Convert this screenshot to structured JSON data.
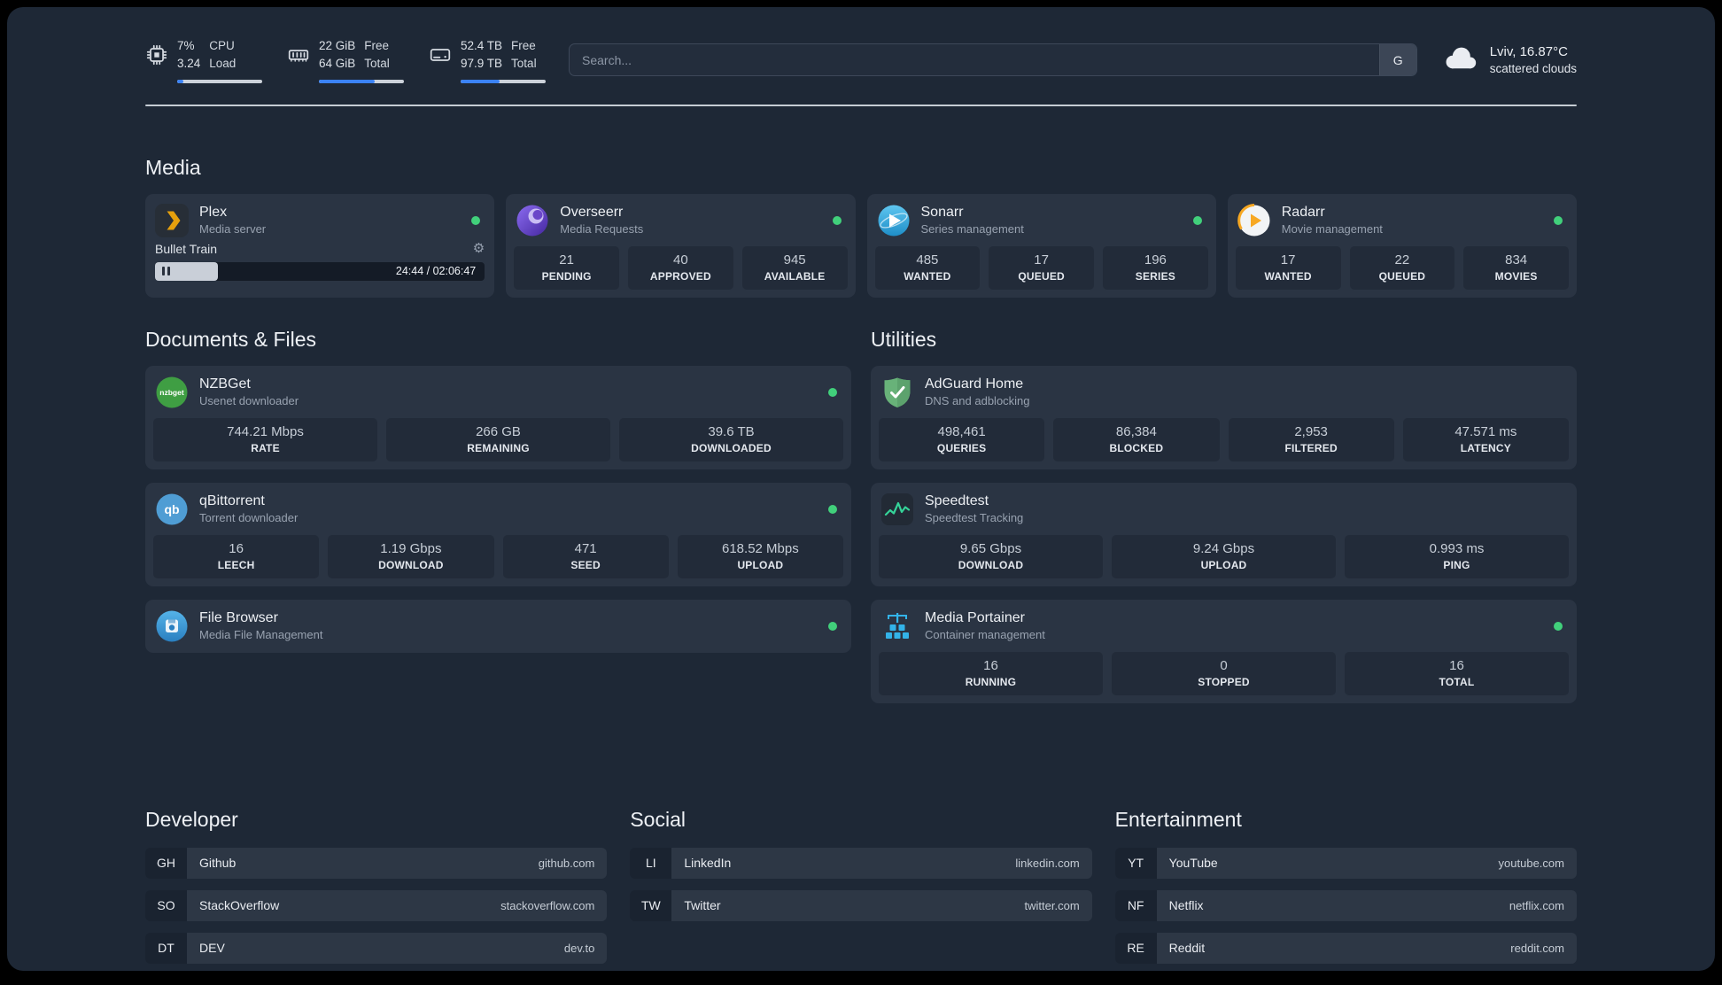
{
  "topbar": {
    "cpu": {
      "value_top": "7%",
      "value_bottom": "3.24",
      "label_top": "CPU",
      "label_bottom": "Load",
      "percent": 7
    },
    "memory": {
      "value_top": "22 GiB",
      "value_bottom": "64 GiB",
      "label_top": "Free",
      "label_bottom": "Total",
      "percent": 66
    },
    "disk": {
      "value_top": "52.4 TB",
      "value_bottom": "97.9 TB",
      "label_top": "Free",
      "label_bottom": "Total",
      "percent": 46
    },
    "search": {
      "placeholder": "Search...",
      "button_label": "G"
    },
    "weather": {
      "location": "Lviv, 16.87°C",
      "condition": "scattered clouds"
    }
  },
  "icons": {
    "gear": "⚙"
  },
  "colors": {
    "accent": "#3b82f6",
    "online": "#41d07b"
  },
  "sections": {
    "media": {
      "title": "Media",
      "plex": {
        "name": "Plex",
        "subtitle": "Media server",
        "status": "online",
        "now_playing": {
          "title": "Bullet Train",
          "time_display": "24:44 / 02:06:47",
          "progress_percent": 19
        }
      },
      "overseerr": {
        "name": "Overseerr",
        "subtitle": "Media Requests",
        "status": "online",
        "stats": [
          {
            "value": "21",
            "label": "PENDING"
          },
          {
            "value": "40",
            "label": "APPROVED"
          },
          {
            "value": "945",
            "label": "AVAILABLE"
          }
        ]
      },
      "sonarr": {
        "name": "Sonarr",
        "subtitle": "Series management",
        "status": "online",
        "stats": [
          {
            "value": "485",
            "label": "WANTED"
          },
          {
            "value": "17",
            "label": "QUEUED"
          },
          {
            "value": "196",
            "label": "SERIES"
          }
        ]
      },
      "radarr": {
        "name": "Radarr",
        "subtitle": "Movie management",
        "status": "online",
        "stats": [
          {
            "value": "17",
            "label": "WANTED"
          },
          {
            "value": "22",
            "label": "QUEUED"
          },
          {
            "value": "834",
            "label": "MOVIES"
          }
        ]
      }
    },
    "documents": {
      "title": "Documents & Files",
      "nzbget": {
        "name": "NZBGet",
        "subtitle": "Usenet downloader",
        "status": "online",
        "stats": [
          {
            "value": "744.21 Mbps",
            "label": "RATE"
          },
          {
            "value": "266 GB",
            "label": "REMAINING"
          },
          {
            "value": "39.6 TB",
            "label": "DOWNLOADED"
          }
        ]
      },
      "qbittorrent": {
        "name": "qBittorrent",
        "subtitle": "Torrent downloader",
        "status": "online",
        "stats": [
          {
            "value": "16",
            "label": "LEECH"
          },
          {
            "value": "1.19 Gbps",
            "label": "DOWNLOAD"
          },
          {
            "value": "471",
            "label": "SEED"
          },
          {
            "value": "618.52 Mbps",
            "label": "UPLOAD"
          }
        ]
      },
      "filebrowser": {
        "name": "File Browser",
        "subtitle": "Media File Management",
        "status": "online"
      }
    },
    "utilities": {
      "title": "Utilities",
      "adguard": {
        "name": "AdGuard Home",
        "subtitle": "DNS and adblocking",
        "stats": [
          {
            "value": "498,461",
            "label": "QUERIES"
          },
          {
            "value": "86,384",
            "label": "BLOCKED"
          },
          {
            "value": "2,953",
            "label": "FILTERED"
          },
          {
            "value": "47.571 ms",
            "label": "LATENCY"
          }
        ]
      },
      "speedtest": {
        "name": "Speedtest",
        "subtitle": "Speedtest Tracking",
        "stats": [
          {
            "value": "9.65 Gbps",
            "label": "DOWNLOAD"
          },
          {
            "value": "9.24 Gbps",
            "label": "UPLOAD"
          },
          {
            "value": "0.993 ms",
            "label": "PING"
          }
        ]
      },
      "portainer": {
        "name": "Media Portainer",
        "subtitle": "Container management",
        "status": "online",
        "stats": [
          {
            "value": "16",
            "label": "RUNNING"
          },
          {
            "value": "0",
            "label": "STOPPED"
          },
          {
            "value": "16",
            "label": "TOTAL"
          }
        ]
      }
    }
  },
  "bookmarks": {
    "developer": {
      "title": "Developer",
      "items": [
        {
          "abbr": "GH",
          "name": "Github",
          "domain": "github.com"
        },
        {
          "abbr": "SO",
          "name": "StackOverflow",
          "domain": "stackoverflow.com"
        },
        {
          "abbr": "DT",
          "name": "DEV",
          "domain": "dev.to"
        }
      ]
    },
    "social": {
      "title": "Social",
      "items": [
        {
          "abbr": "LI",
          "name": "LinkedIn",
          "domain": "linkedin.com"
        },
        {
          "abbr": "TW",
          "name": "Twitter",
          "domain": "twitter.com"
        }
      ]
    },
    "entertainment": {
      "title": "Entertainment",
      "items": [
        {
          "abbr": "YT",
          "name": "YouTube",
          "domain": "youtube.com"
        },
        {
          "abbr": "NF",
          "name": "Netflix",
          "domain": "netflix.com"
        },
        {
          "abbr": "RE",
          "name": "Reddit",
          "domain": "reddit.com"
        }
      ]
    }
  }
}
